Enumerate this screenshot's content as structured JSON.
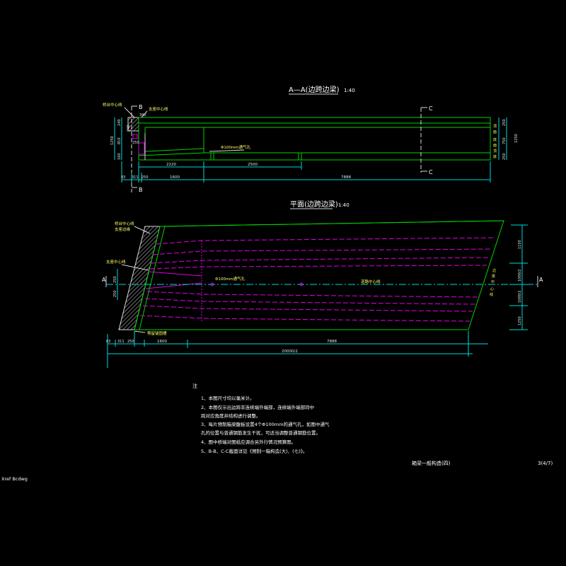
{
  "section_view": {
    "title": "A—A(边跨边梁)",
    "scale": "1:40",
    "cut_b_top": "B",
    "cut_b_bottom": "B",
    "cut_c_top": "C",
    "cut_c_bottom": "C",
    "label_abutment_line": "桥台中心线",
    "label_support_line": "支座中心线",
    "label_pipe": "Φ100mm通气孔",
    "left_dims": [
      "1250",
      "240",
      "810",
      "160",
      "240"
    ],
    "top_dim": "340",
    "left_inner_dim": "250",
    "right_dims": [
      "1250",
      "250",
      "750",
      "250"
    ],
    "right_small_labels": [
      "顶",
      "面",
      "底",
      "面",
      "顶",
      "底"
    ],
    "bottom_dims": [
      "2220",
      "2500"
    ],
    "bottom_dims_row2": [
      "83",
      "311",
      "250",
      "1600",
      "7888"
    ]
  },
  "plan_view": {
    "title": "平面(边跨边梁)",
    "scale": "1:40",
    "label_abutment_line": "桥台中心线",
    "label_support_edge": "支座边缘",
    "label_support_line": "支座中心线",
    "label_end_block": "预留锚固槽",
    "label_pipe": "Φ100mm通气孔",
    "label_center_line": "道路中心线",
    "cut_a_left": "A",
    "cut_a_right": "A",
    "right_dims": [
      "1150",
      "1000/2",
      "1000/2",
      "1250"
    ],
    "left_dims": [
      "250",
      "250"
    ],
    "right_vertical_text": [
      "边",
      "梁",
      "中",
      "心",
      "线"
    ],
    "bottom_dims_row1": [
      "83",
      "311",
      "250",
      "1600",
      "7888"
    ],
    "bottom_dims_row2": [
      "20000/2"
    ]
  },
  "notes": {
    "heading": "注",
    "items": [
      "1、本图尺寸均以毫米计。",
      "2、本图仅示出边跨非连续端外端部，连续端外端部同中",
      "   跨对应角度并结构进行调整。",
      "3、每片预制箱梁腹板设置4个Φ100mm的通气孔，如图中通气",
      "   孔的位置与普通钢筋发生干扰，可适当调整普通钢筋位置。",
      "4、图中桥端对图纸应调合另外行情况预算图。",
      "5、B-B、C-C截面详见《预制一箱构造(大)、(七)》。"
    ]
  },
  "footer": {
    "drawing_title": "箱梁一般构造(四)",
    "sheet": "3(4/7)",
    "xref_label": "Xref Bcdwg"
  },
  "colors": {
    "background": "#000000",
    "outline_green": "#00d200",
    "dimension_cyan": "#00d8d8",
    "tendon_magenta": "#e000e0",
    "text_white": "#ffffff"
  }
}
